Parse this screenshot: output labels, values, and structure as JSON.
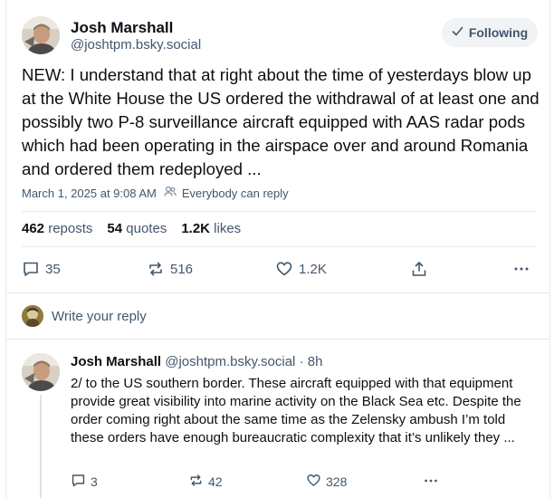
{
  "post": {
    "author_name": "Josh Marshall",
    "author_handle": "@joshtpm.bsky.social",
    "follow_label": "Following",
    "text": "NEW: I understand that at right about the time of yesterdays blow up at the White House the US ordered the withdrawal of at least one and possibly two P-8 surveillance aircraft equipped with AAS radar pods which had been operating in the airspace over and around Romania and ordered them redeployed ...",
    "timestamp": "March 1, 2025 at 9:08 AM",
    "reply_setting": "Everybody can reply",
    "reposts_count": "462",
    "reposts_label": "reposts",
    "quotes_count": "54",
    "quotes_label": "quotes",
    "likes_count": "1.2K",
    "likes_label": "likes",
    "actions": {
      "reply_count": "35",
      "repost_count": "516",
      "like_count": "1.2K"
    }
  },
  "composer": {
    "placeholder": "Write your reply"
  },
  "reply": {
    "author_name": "Josh Marshall",
    "author_handle": "@joshtpm.bsky.social",
    "separator": "·",
    "age": "8h",
    "text": "2/ to the US southern border. These aircraft equipped with that equipment provide great visibility into marine activity on the Black Sea etc. Despite the order coming right about the same time as the Zelensky ambush I’m told these orders have enough bureaucratic complexity that it’s unlikely they ...",
    "actions": {
      "reply_count": "3",
      "repost_count": "42",
      "like_count": "328"
    }
  },
  "icons": [
    "check-icon",
    "people-icon",
    "comment-icon",
    "repost-icon",
    "heart-icon",
    "share-icon",
    "more-icon"
  ],
  "colors": {
    "text": "#0b0f14",
    "muted": "#42576c",
    "border": "#e6e9ee",
    "button_bg": "#f1f3f5"
  }
}
